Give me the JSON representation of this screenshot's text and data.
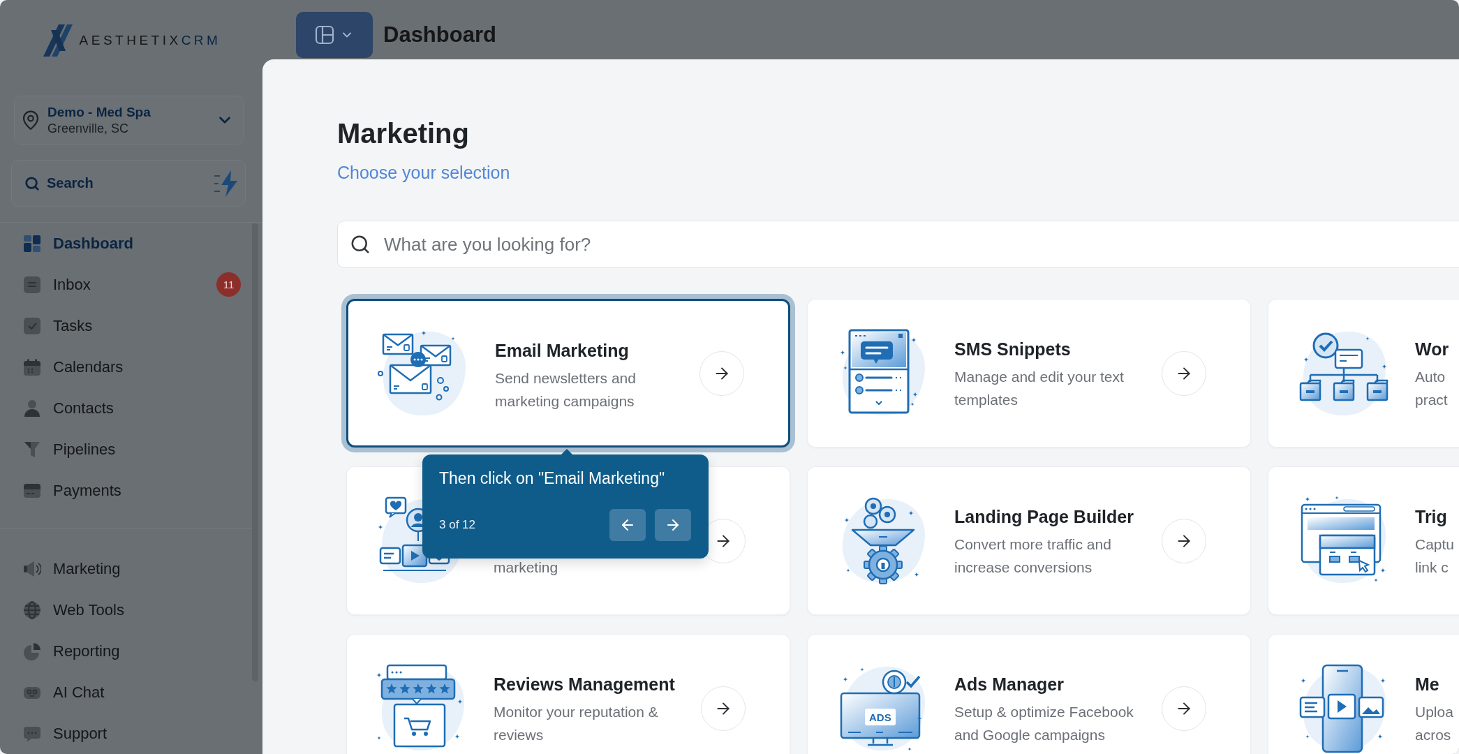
{
  "sidebar": {
    "logo": {
      "text": "AESTHETIX",
      "accent": "CRM"
    },
    "location": {
      "name": "Demo - Med Spa",
      "address": "Greenville, SC"
    },
    "search": {
      "label": "Search"
    },
    "sections": [
      {
        "items": [
          {
            "kind": "dashboard",
            "label": "Dashboard",
            "selected": true
          },
          {
            "kind": "inbox",
            "label": "Inbox",
            "selected": false,
            "badge": "11"
          },
          {
            "kind": "tasks",
            "label": "Tasks",
            "selected": false
          },
          {
            "kind": "calendar",
            "label": "Calendars",
            "selected": false
          },
          {
            "kind": "contacts",
            "label": "Contacts",
            "selected": false
          },
          {
            "kind": "pipelines",
            "label": "Pipelines",
            "selected": false
          },
          {
            "kind": "payments",
            "label": "Payments",
            "selected": false
          }
        ]
      },
      {
        "items": [
          {
            "kind": "marketing",
            "label": "Marketing",
            "selected": false
          },
          {
            "kind": "webtools",
            "label": "Web Tools",
            "selected": false
          },
          {
            "kind": "reporting",
            "label": "Reporting",
            "selected": false
          },
          {
            "kind": "chat",
            "label": "AI Chat",
            "selected": false
          },
          {
            "kind": "support",
            "label": "Support",
            "selected": false
          }
        ]
      }
    ]
  },
  "header": {
    "title": "Dashboard"
  },
  "modal": {
    "title": "Marketing",
    "subtitle": "Choose your selection",
    "search": {
      "placeholder": "What are you looking for?"
    },
    "cards": [
      {
        "kind": "email",
        "title": "Email Marketing",
        "description": "Send newsletters and marketing campaigns",
        "highlighted": true
      },
      {
        "kind": "sms",
        "title": "SMS Snippets",
        "description": "Manage and edit your text templates",
        "highlighted": false
      },
      {
        "kind": "workflow",
        "title": "Wor",
        "description": "Auto\npract",
        "highlighted": false
      },
      {
        "kind": "social",
        "description": "marketing",
        "highlighted": false
      },
      {
        "kind": "funnel",
        "title": "Landing Page Builder",
        "description": "Convert more traffic and increase conversions",
        "highlighted": false
      },
      {
        "kind": "trigger",
        "title": "Trig",
        "description": "Captu\nlink c",
        "highlighted": false
      },
      {
        "kind": "reviews",
        "title": "Reviews Management",
        "description": "Monitor your reputation & reviews",
        "highlighted": false
      },
      {
        "kind": "ads",
        "title": "Ads Manager",
        "description": "Setup & optimize Facebook and Google campaigns",
        "highlighted": false,
        "art_text": "ADS"
      },
      {
        "kind": "media",
        "title": "Me",
        "description": "Uploa\nacros",
        "highlighted": false
      }
    ],
    "tour": {
      "text": "Then click on \"Email Marketing\"",
      "step": "3 of 12"
    }
  }
}
